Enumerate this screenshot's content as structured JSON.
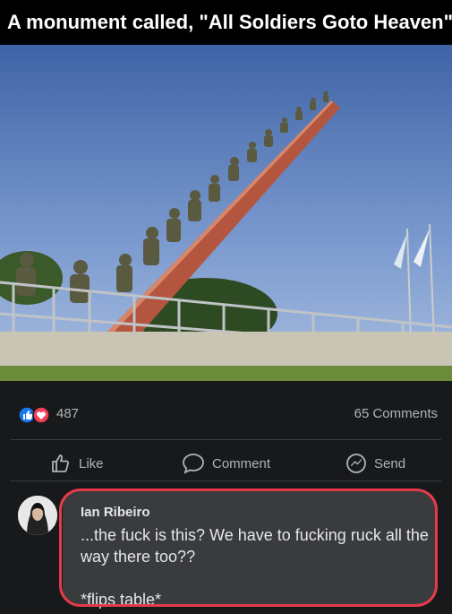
{
  "caption": "A monument called, \"All Soldiers Goto Heaven\"",
  "post": {
    "reaction_icons": [
      "like-icon",
      "love-icon"
    ],
    "reaction_count": "487",
    "comments_count": "65 Comments",
    "actions": {
      "like": "Like",
      "comment": "Comment",
      "send": "Send"
    }
  },
  "comment": {
    "author": "Ian Ribeiro",
    "text": "...the fuck is this? We have to fucking ruck all the way there too??\n\n*flips table*"
  },
  "colors": {
    "background": "#18191a",
    "text": "#e4e6eb",
    "muted": "#b0b3b8",
    "highlight_outline": "#e63a4a",
    "like_blue": "#1877f2",
    "love_red": "#f33e58"
  }
}
